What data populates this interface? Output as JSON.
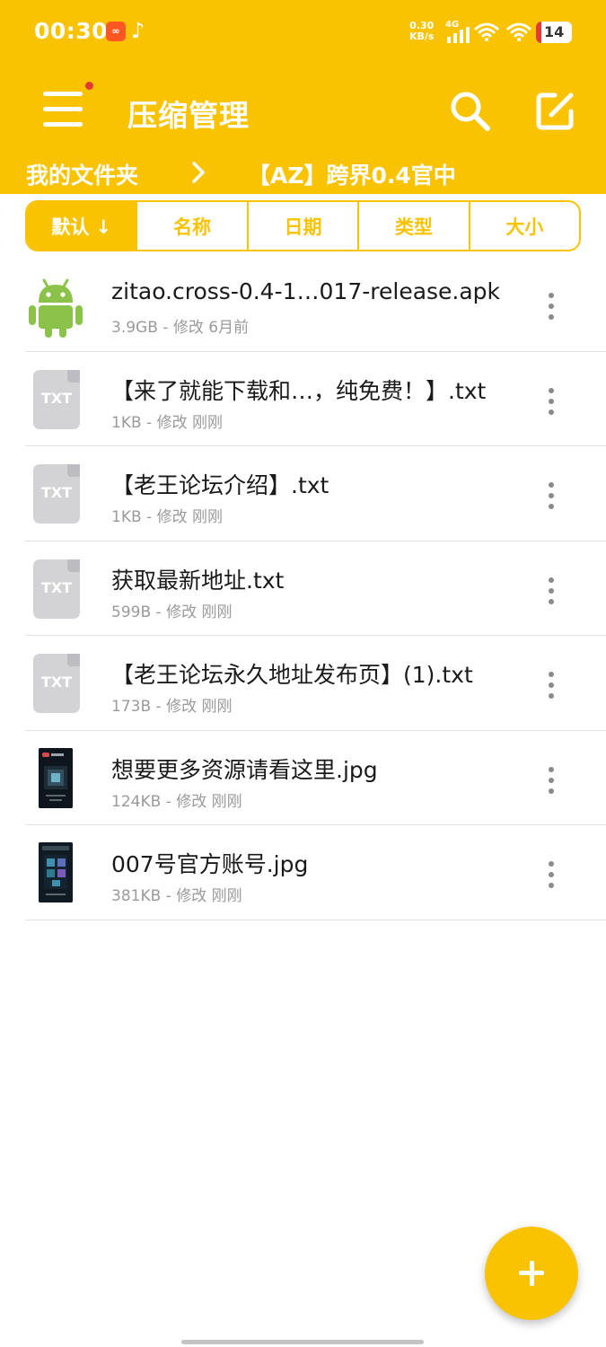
{
  "status_bar": {
    "time": "00:30",
    "net_speed_value": "0.30",
    "net_speed_unit": "KB/s",
    "network_type": "4G",
    "battery_level": "14"
  },
  "app_bar": {
    "title": "压缩管理",
    "menu_has_notification": true
  },
  "breadcrumb": {
    "root": "我的文件夹",
    "current": "【AZ】跨界0.4官中"
  },
  "sort_tabs": [
    {
      "label": "默认 ↓",
      "active": true
    },
    {
      "label": "名称",
      "active": false
    },
    {
      "label": "日期",
      "active": false
    },
    {
      "label": "类型",
      "active": false
    },
    {
      "label": "大小",
      "active": false
    }
  ],
  "files": [
    {
      "name": "zitao.cross-0.4-1…017-release.apk",
      "size": "3.9GB",
      "meta_sep": " - ",
      "modified": "修改 6月前",
      "icon": "android-icon"
    },
    {
      "name": "【来了就能下载和…，纯免费！】.txt",
      "size": "1KB",
      "meta_sep": " - ",
      "modified": "修改 刚刚",
      "icon": "txt-file-icon",
      "icon_label": "TXT"
    },
    {
      "name": "【老王论坛介绍】.txt",
      "size": "1KB",
      "meta_sep": " - ",
      "modified": "修改 刚刚",
      "icon": "txt-file-icon",
      "icon_label": "TXT"
    },
    {
      "name": "获取最新地址.txt",
      "size": "599B",
      "meta_sep": " - ",
      "modified": "修改 刚刚",
      "icon": "txt-file-icon",
      "icon_label": "TXT"
    },
    {
      "name": "【老王论坛永久地址发布页】(1).txt",
      "size": "173B",
      "meta_sep": " - ",
      "modified": "修改 刚刚",
      "icon": "txt-file-icon",
      "icon_label": "TXT"
    },
    {
      "name": "想要更多资源请看这里.jpg",
      "size": "124KB",
      "meta_sep": " - ",
      "modified": "修改 刚刚",
      "icon": "image-thumbnail"
    },
    {
      "name": "007号官方账号.jpg",
      "size": "381KB",
      "meta_sep": " - ",
      "modified": "修改 刚刚",
      "icon": "image-thumbnail"
    }
  ],
  "fab": {
    "icon": "plus-icon"
  },
  "colors": {
    "accent": "#F9C301",
    "text_primary": "#1a1a1a",
    "text_secondary": "#9a9a9a",
    "android_green": "#8BC34A"
  }
}
